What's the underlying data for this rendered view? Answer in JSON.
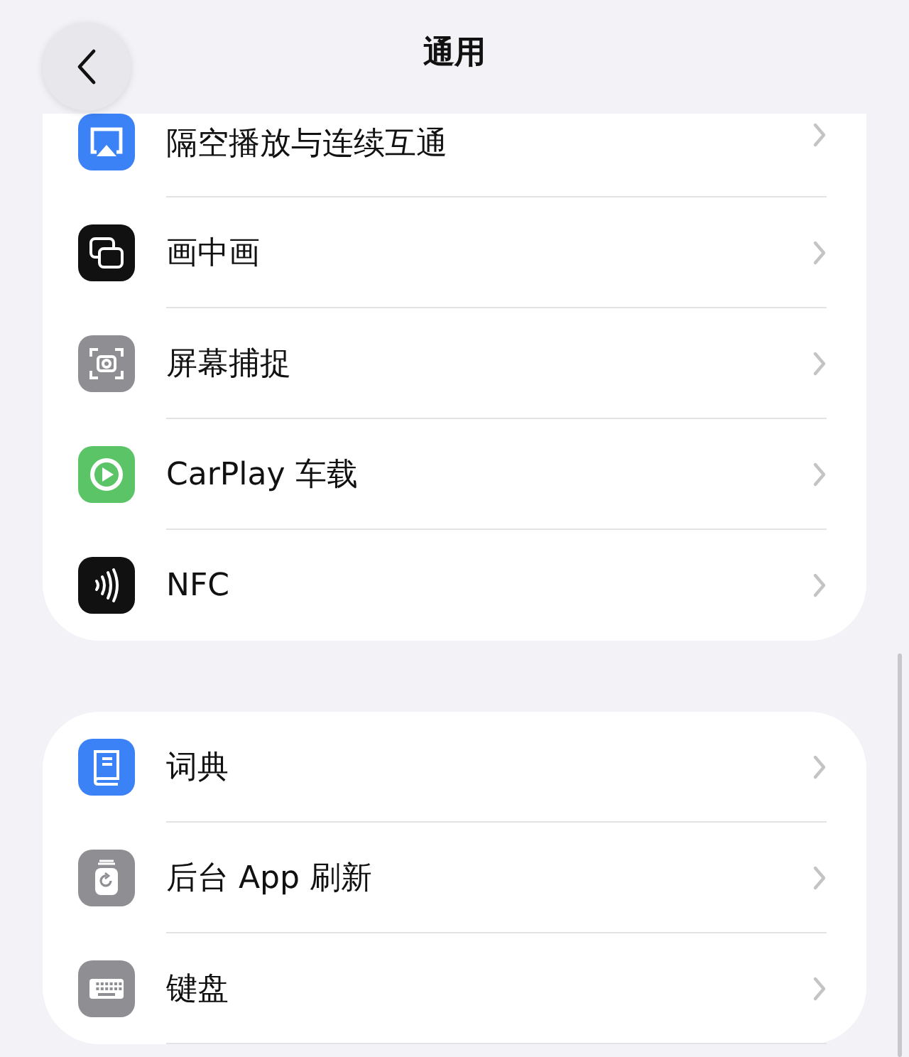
{
  "nav_bar": {
    "title": "通用"
  },
  "groups": [
    {
      "items": [
        {
          "label": "隔空播放与连续互通"
        },
        {
          "label": "画中画"
        },
        {
          "label": "屏幕捕捉"
        },
        {
          "label": "CarPlay 车载"
        },
        {
          "label": "NFC"
        }
      ]
    },
    {
      "items": [
        {
          "label": "词典"
        },
        {
          "label": "后台 App 刷新"
        },
        {
          "label": "键盘"
        }
      ]
    }
  ]
}
